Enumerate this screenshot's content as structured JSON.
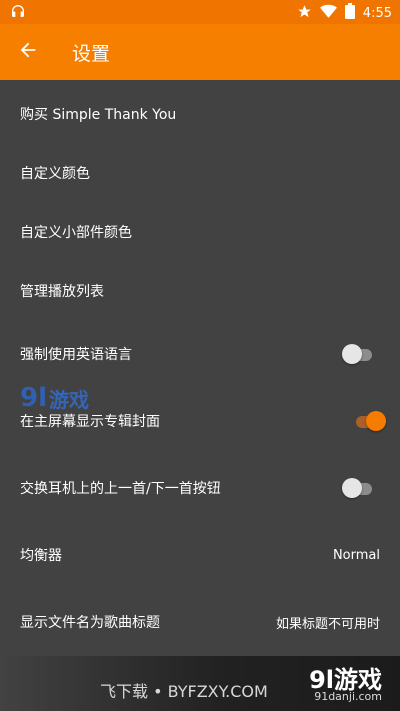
{
  "status_bar": {
    "time": "4:55",
    "left_icon": "headphones-icon",
    "right_icons": [
      "star-icon",
      "wifi-icon",
      "battery-icon"
    ]
  },
  "app_bar": {
    "title": "设置",
    "back_icon": "arrow-left-icon"
  },
  "colors": {
    "accent": "#f77f00",
    "status_bar": "#ef7400",
    "background": "#424242"
  },
  "settings": [
    {
      "label": "购买 Simple Thank You"
    },
    {
      "label": "自定义颜色"
    },
    {
      "label": "自定义小部件颜色"
    },
    {
      "label": "管理播放列表"
    },
    {
      "label": "强制使用英语语言",
      "toggle": false
    },
    {
      "label": "在主屏幕显示专辑封面",
      "toggle": true
    },
    {
      "label": "交换耳机上的上一首/下一首按钮",
      "toggle": false
    },
    {
      "label": "均衡器",
      "value": "Normal"
    },
    {
      "label": "显示文件名为歌曲标题",
      "value": "如果标题不可用时"
    }
  ],
  "watermarks": {
    "top_mark": "9l",
    "top_text": "游戏",
    "bottom_fei": "飞下载 • BYFZXY.COM",
    "bottom_logo": "9l游戏",
    "bottom_url": "91danji.com"
  }
}
